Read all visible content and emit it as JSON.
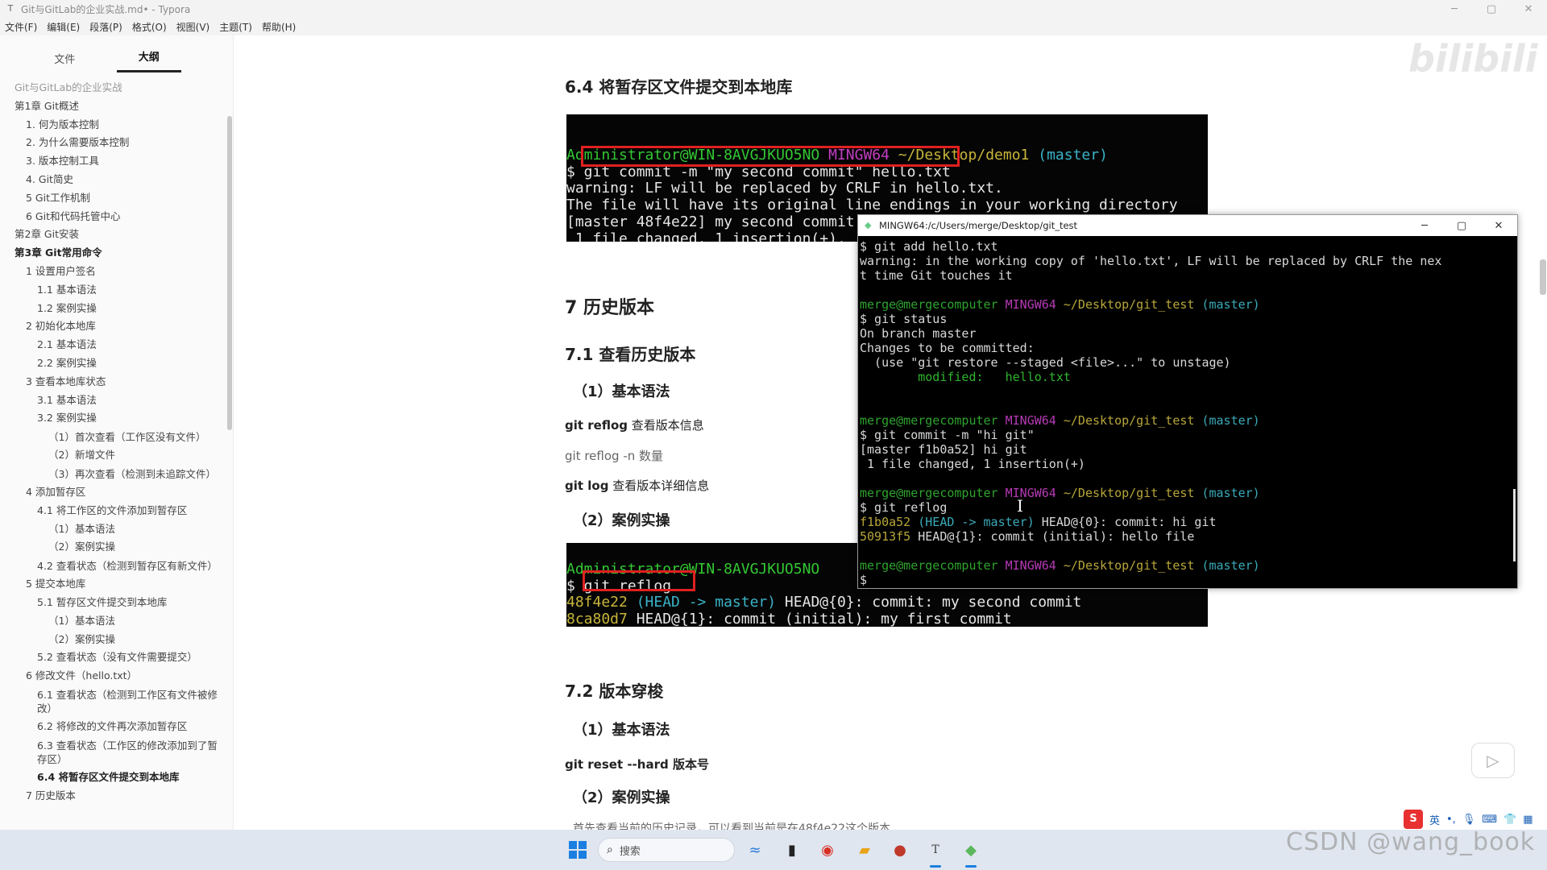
{
  "window": {
    "title": "Git与GitLab的企业实战.md• - Typora",
    "app_icon": "T",
    "controls": [
      "─",
      "▢",
      "✕"
    ]
  },
  "menu": [
    "文件(F)",
    "编辑(E)",
    "段落(P)",
    "格式(O)",
    "视图(V)",
    "主题(T)",
    "帮助(H)"
  ],
  "sidebar": {
    "tabs": [
      "文件",
      "大纲"
    ],
    "active_tab": "大纲",
    "outline": [
      {
        "text": "Git与GitLab的企业实战",
        "level": 1,
        "faded": true
      },
      {
        "text": "第1章 Git概述",
        "level": 1
      },
      {
        "text": "1. 何为版本控制",
        "level": 2
      },
      {
        "text": "2. 为什么需要版本控制",
        "level": 2
      },
      {
        "text": "3. 版本控制工具",
        "level": 2
      },
      {
        "text": "4. Git简史",
        "level": 2
      },
      {
        "text": "5 Git工作机制",
        "level": 2
      },
      {
        "text": "6 Git和代码托管中心",
        "level": 2
      },
      {
        "text": "第2章 Git安装",
        "level": 1
      },
      {
        "text": "第3章 Git常用命令",
        "level": 1,
        "bold": true
      },
      {
        "text": "1 设置用户签名",
        "level": 2
      },
      {
        "text": "1.1 基本语法",
        "level": 3
      },
      {
        "text": "1.2 案例实操",
        "level": 3
      },
      {
        "text": "2 初始化本地库",
        "level": 2
      },
      {
        "text": "2.1 基本语法",
        "level": 3
      },
      {
        "text": "2.2 案例实操",
        "level": 3
      },
      {
        "text": "3 查看本地库状态",
        "level": 2
      },
      {
        "text": "3.1 基本语法",
        "level": 3
      },
      {
        "text": "3.2 案例实操",
        "level": 3
      },
      {
        "text": "（1）首次查看（工作区没有文件）",
        "level": 4,
        "wrap": true
      },
      {
        "text": "（2）新增文件",
        "level": 4
      },
      {
        "text": "（3）再次查看（检测到未追踪文件）",
        "level": 4,
        "wrap": true
      },
      {
        "text": "4 添加暂存区",
        "level": 2
      },
      {
        "text": "4.1 将工作区的文件添加到暂存区",
        "level": 3
      },
      {
        "text": "（1）基本语法",
        "level": 4
      },
      {
        "text": "（2）案例实操",
        "level": 4
      },
      {
        "text": "4.2 查看状态（检测到暂存区有新文件）",
        "level": 3,
        "wrap": true
      },
      {
        "text": "5 提交本地库",
        "level": 2
      },
      {
        "text": "5.1 暂存区文件提交到本地库",
        "level": 3
      },
      {
        "text": "（1）基本语法",
        "level": 4
      },
      {
        "text": "（2）案例实操",
        "level": 4
      },
      {
        "text": "5.2 查看状态（没有文件需要提交）",
        "level": 3
      },
      {
        "text": "6 修改文件（hello.txt）",
        "level": 2
      },
      {
        "text": "6.1 查看状态（检测到工作区有文件被修改）",
        "level": 3,
        "wrap": true
      },
      {
        "text": "6.2 将修改的文件再次添加暂存区",
        "level": 3
      },
      {
        "text": "6.3 查看状态（工作区的修改添加到了暂存区）",
        "level": 3,
        "wrap": true
      },
      {
        "text": "6.4 将暂存区文件提交到本地库",
        "level": 3,
        "bold": true
      },
      {
        "text": "7 历史版本",
        "level": 2
      }
    ],
    "footer_icons": [
      "‹",
      "</>"
    ]
  },
  "doc": {
    "h_64": "6.4 将暂存区文件提交到本地库",
    "h_7": "7 历史版本",
    "h_71": "7.1 查看历史版本",
    "h_basic1": "（1）基本语法",
    "p_reflog_cmd": "git reflog",
    "p_reflog_desc": " 查看版本信息",
    "p_reflog_n": "git reflog -n 数量",
    "p_log_cmd": "git log",
    "p_log_desc": " 查看版本详细信息",
    "h_case1": "（2）案例实操",
    "h_72": "7.2 版本穿梭",
    "h_basic2": "（1）基本语法",
    "p_reset": "git reset --hard 版本号",
    "h_case2": "（2）案例实操",
    "p_tail": "首先查看当前的历史记录，可以看到当前是在48f4e22这个版本"
  },
  "shot1": {
    "prompt_user": "Administrator@WIN-8AVGJKUO5NO",
    "prompt_env": "MINGW64",
    "prompt_path": "~/Desktop/demo1",
    "prompt_branch": "(master)",
    "cmd": "$ git commit -m \"my second commit\" hello.txt",
    "l1": "warning: LF will be replaced by CRLF in hello.txt.",
    "l2": "The file will have its original line endings in your working directory",
    "l3": "[master 48f4e22] my second commit",
    "l4": " 1 file changed, 1 insertion(+),"
  },
  "shot2": {
    "prompt_user": "Administrator@WIN-8AVGJKUO5NO",
    "cmd": "$ git reflog",
    "l1_hash": "48f4e22",
    "l1_ref": " (HEAD -> master)",
    "l1_rest": " HEAD@{0}: commit: my second commit",
    "l2_hash": "8ca80d7",
    "l2_rest": " HEAD@{1}: commit (initial): my first commit"
  },
  "terminal": {
    "title": "MINGW64:/c/Users/merge/Desktop/git_test",
    "lines": {
      "a1": "$ git add hello.txt",
      "a2": "warning: in the working copy of 'hello.txt', LF will be replaced by CRLF the nex",
      "a3": "t time Git touches it",
      "p_user": "merge@mergecomputer",
      "p_env": "MINGW64",
      "p_path": "~/Desktop/git_test",
      "p_branch": "(master)",
      "b1": "$ git status",
      "b2": "On branch master",
      "b3": "Changes to be committed:",
      "b4": "  (use \"git restore --staged <file>...\" to unstage)",
      "b5": "        modified:   hello.txt",
      "c1": "$ git commit -m \"hi git\"",
      "c2": "[master f1b0a52] hi git",
      "c3": " 1 file changed, 1 insertion(+)",
      "d1": "$ git reflog",
      "d2_hash": "f1b0a52",
      "d2_ref": " (HEAD -> master)",
      "d2_rest": " HEAD@{0}: commit: hi git",
      "d3_hash": "50913f5",
      "d3_rest": " HEAD@{1}: commit (initial): hello file",
      "e1": "$"
    }
  },
  "taskbar": {
    "search_placeholder": "搜索",
    "apps": [
      "edge-like",
      "file-explorer",
      "chrome",
      "folder",
      "video-app",
      "typora",
      "git-bash"
    ]
  },
  "overlay": {
    "watermark": "CSDN @wang_book",
    "bili": "bilibili",
    "ime_lang": "英",
    "tray": [
      "系统托盘"
    ]
  }
}
